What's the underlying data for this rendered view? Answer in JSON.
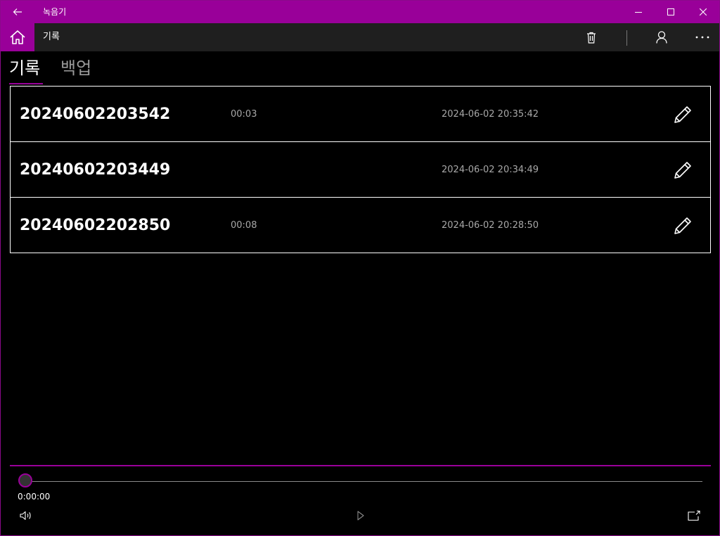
{
  "window": {
    "title": "녹음기"
  },
  "commandbar": {
    "title": "기록"
  },
  "pivot": {
    "tabs": [
      {
        "label": "기록",
        "active": true
      },
      {
        "label": "백업",
        "active": false
      }
    ]
  },
  "recordings": [
    {
      "name": "20240602203542",
      "duration": "00:03",
      "date": "2024-06-02 20:35:42"
    },
    {
      "name": "20240602203449",
      "duration": "",
      "date": "2024-06-02 20:34:49"
    },
    {
      "name": "20240602202850",
      "duration": "00:08",
      "date": "2024-06-02 20:28:50"
    }
  ],
  "player": {
    "position": "0:00:00",
    "progress_fraction": 0
  },
  "colors": {
    "accent": "#990099",
    "commandbar_bg": "#1f1f1f",
    "background": "#000000",
    "secondary_text": "#a8a8a8"
  },
  "icons": {
    "back": "back-arrow-icon",
    "minimize": "minimize-icon",
    "maximize": "maximize-icon",
    "close": "close-icon",
    "home": "home-icon",
    "delete": "trash-icon",
    "account": "person-icon",
    "more": "more-icon",
    "edit": "pencil-icon",
    "volume": "volume-icon",
    "play": "play-icon",
    "cast": "cast-icon"
  }
}
